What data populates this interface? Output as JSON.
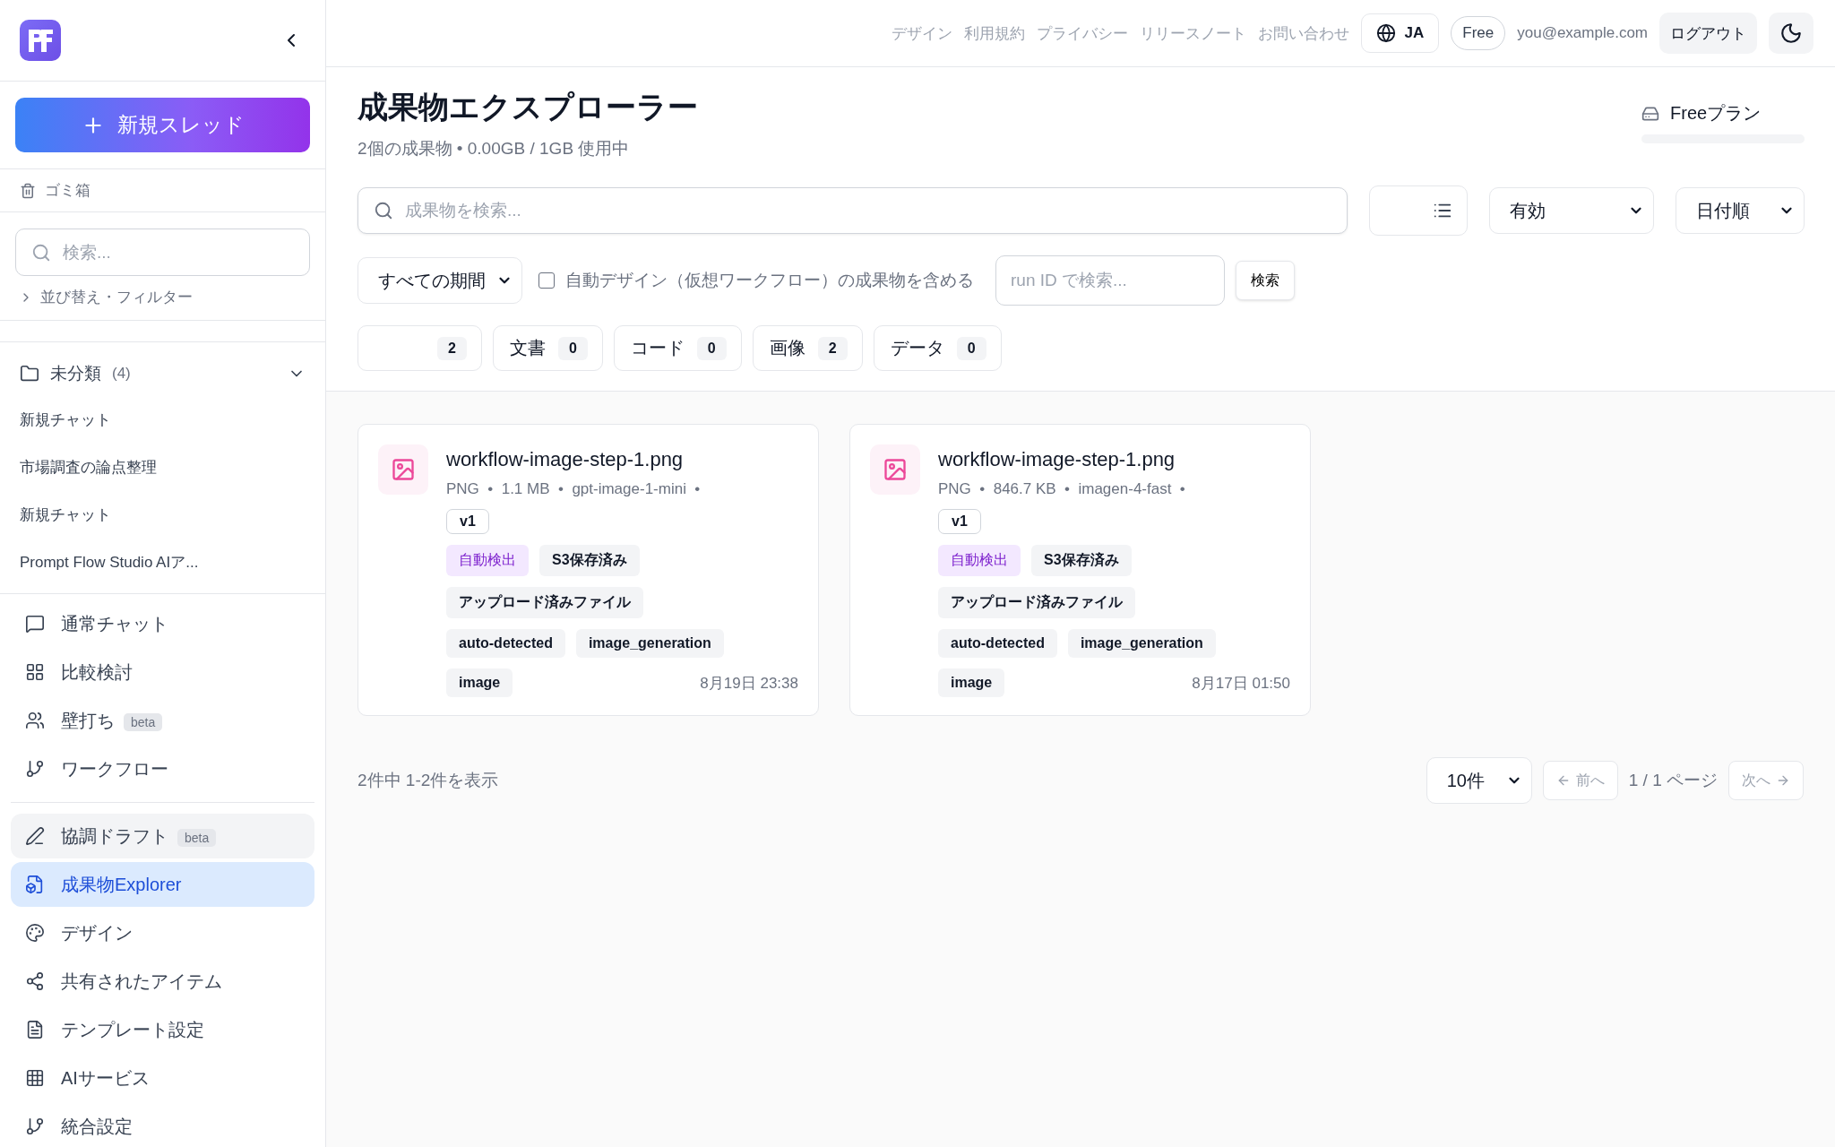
{
  "sidebar": {
    "new_thread_button": "新規スレッド",
    "trash": "ゴミ箱",
    "search": {
      "placeholder": "検索..."
    },
    "sort_filter": {
      "label": "並び替え・フィルター",
      "expanded": false
    },
    "folder": {
      "label": "未分類",
      "count": "(4)",
      "expanded": true,
      "items": [
        "新規チャット",
        "市場調査の論点整理",
        "新規チャット",
        "Prompt Flow Studio AIア..."
      ]
    },
    "nav_groups": [
      [
        {
          "label": "通常チャット",
          "selected": false,
          "hovered": false
        },
        {
          "label": "比較検討",
          "selected": false,
          "hovered": false
        },
        {
          "label": "壁打ち",
          "badge": "beta",
          "selected": false,
          "hovered": false
        },
        {
          "label": "ワークフロー",
          "selected": false,
          "hovered": false
        }
      ],
      [
        {
          "label": "協調ドラフト",
          "badge": "beta",
          "selected": false,
          "hovered": true
        },
        {
          "label": "成果物Explorer",
          "selected": true,
          "hovered": false
        },
        {
          "label": "デザイン",
          "selected": false,
          "hovered": false
        },
        {
          "label": "共有されたアイテム",
          "selected": false,
          "hovered": false
        },
        {
          "label": "テンプレート設定",
          "selected": false,
          "hovered": false
        },
        {
          "label": "AIサービス",
          "selected": false,
          "hovered": false
        },
        {
          "label": "統合設定",
          "selected": false,
          "hovered": false
        }
      ]
    ]
  },
  "header": {
    "links": [
      "デザイン",
      "利用規約",
      "プライバシー",
      "リリースノート",
      "お問い合わせ"
    ],
    "language": "JA",
    "plan_badge": "Free",
    "email": "you@example.com",
    "logout": "ログアウト"
  },
  "page": {
    "title": "成果物エクスプローラー",
    "subtitle": "2個の成果物 • 0.00GB / 1GB 使用中",
    "plan": {
      "label": "Freeプラン",
      "level": 0
    },
    "search": {
      "placeholder": "成果物を検索..."
    },
    "status_select": "有効",
    "sort_select": "日付順",
    "period_select": "すべての期間",
    "include_auto": {
      "label": "自動デザイン（仮想ワークフロー）の成果物を含める",
      "checked": false
    },
    "run_id": {
      "placeholder": "run ID で検索..."
    },
    "search_button": "検索",
    "type_filters": [
      {
        "count": "2"
      },
      {
        "label": "文書",
        "count": "0"
      },
      {
        "label": "コード",
        "count": "0"
      },
      {
        "label": "画像",
        "count": "2"
      },
      {
        "label": "データ",
        "count": "0"
      }
    ],
    "artifacts": [
      {
        "name": "workflow-image-step-1.png",
        "meta": "PNG  •  1.1 MB  •  gpt-image-1-mini  •",
        "version": "v1",
        "tag_rows": [
          [
            {
              "text": "自動検出",
              "kind": "accent"
            },
            {
              "text": "S3保存済み",
              "kind": "plain"
            }
          ],
          [
            {
              "text": "アップロード済みファイル",
              "kind": "plain"
            }
          ],
          [
            {
              "text": "auto-detected",
              "kind": "plain"
            },
            {
              "text": "image_generation",
              "kind": "plain"
            }
          ],
          [
            {
              "text": "image",
              "kind": "plain"
            }
          ]
        ],
        "date": "8月19日 23:38"
      },
      {
        "name": "workflow-image-step-1.png",
        "meta": "PNG  •  846.7 KB  •  imagen-4-fast  •",
        "version": "v1",
        "tag_rows": [
          [
            {
              "text": "自動検出",
              "kind": "accent"
            },
            {
              "text": "S3保存済み",
              "kind": "plain"
            }
          ],
          [
            {
              "text": "アップロード済みファイル",
              "kind": "plain"
            }
          ],
          [
            {
              "text": "auto-detected",
              "kind": "plain"
            },
            {
              "text": "image_generation",
              "kind": "plain"
            }
          ],
          [
            {
              "text": "image",
              "kind": "plain"
            }
          ]
        ],
        "date": "8月17日 01:50"
      }
    ],
    "pagination": {
      "summary": "2件中 1-2件を表示",
      "page_size": "10件",
      "prev": "前へ",
      "page": "1 / 1 ページ",
      "next": "次へ"
    }
  }
}
